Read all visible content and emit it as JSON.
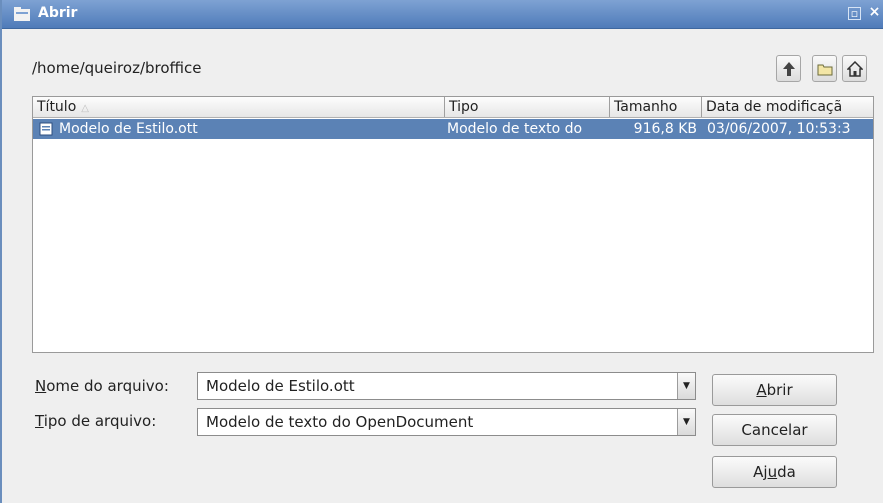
{
  "window": {
    "title": "Abrir"
  },
  "path": "/home/queiroz/broffice",
  "toolbar": {
    "up_icon": "up-one-level-icon",
    "new_folder_icon": "new-folder-icon",
    "home_icon": "home-folder-icon"
  },
  "columns": {
    "title": "Título",
    "type": "Tipo",
    "size": "Tamanho",
    "modified": "Data de modificaçã"
  },
  "files": [
    {
      "name": "Modelo de Estilo.ott",
      "type": "Modelo de texto do",
      "size": "916,8 KB",
      "modified": "03/06/2007, 10:53:3"
    }
  ],
  "form": {
    "filename": {
      "label_ul": "N",
      "label_rest": "ome do arquivo:",
      "value": "Modelo de Estilo.ott"
    },
    "filetype": {
      "label_ul": "T",
      "label_rest": "ipo de arquivo:",
      "value": "Modelo de texto do OpenDocument"
    }
  },
  "buttons": {
    "open": {
      "ul": "A",
      "rest": "brir"
    },
    "cancel": "Cancelar",
    "help": {
      "pre": "Aj",
      "ul": "u",
      "post": "da"
    }
  },
  "colors": {
    "titlebar": "#5b84bd",
    "selection": "#5b82b5"
  }
}
